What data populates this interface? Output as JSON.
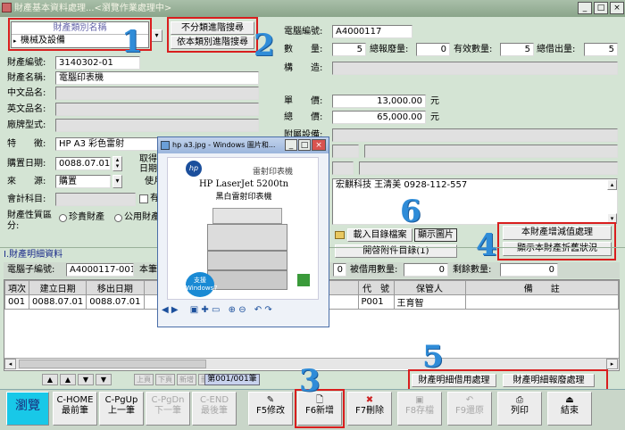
{
  "window": {
    "title": "財產基本資料處理...<瀏覽作業處理中>"
  },
  "category": {
    "header": "財產類別名稱",
    "value": "機械及設備"
  },
  "search_buttons": {
    "all": "不分類進階搜尋",
    "by_category": "依本類別進階搜尋"
  },
  "annotations": [
    "1",
    "2",
    "3",
    "4",
    "5",
    "6"
  ],
  "left_fields": {
    "asset_no_label": "財產編號:",
    "asset_no": "3140302-01",
    "asset_name_label": "財產名稱:",
    "asset_name": "電腦印表機",
    "chinese_name_label": "中文品名:",
    "english_name_label": "英文品名:",
    "model_label": "廠牌型式:",
    "feature_label": "特　　徵:",
    "feature": "HP A3 彩色雷射",
    "purchase_date_label": "購置日期:",
    "purchase_date": "0088.07.01",
    "source_label": "來　　源:",
    "source": "購置",
    "account_label": "會計科目:",
    "acquire_label": "取得",
    "date_label": "日期",
    "use_label": "使月",
    "has_label": "有",
    "nature_label": "財產性質區分:",
    "radio_precious": "珍貴財產",
    "radio_public": "公用財產"
  },
  "right_fields": {
    "computer_no_label": "電腦編號:",
    "computer_no": "A4000117",
    "qty_label": "數　　量:",
    "qty": "5",
    "total_scrap_label": "總報廢量:",
    "total_scrap": "0",
    "valid_qty_label": "有效數量:",
    "valid_qty": "5",
    "total_lent_label": "總借出量:",
    "total_lent": "5",
    "structure_label": "構　　造:",
    "unit_price_label": "單　　價:",
    "unit_price": "13,000.00",
    "unit_price_unit": "元",
    "total_price_label": "總　　價:",
    "total_price": "65,000.00",
    "total_price_unit": "元",
    "attach_label": "附屬設備:",
    "vendor_note": "宏麒科技 王清美 0928-112-557"
  },
  "attachment_buttons": {
    "load": "載入目錄檔案",
    "show_image": "顯示圖片",
    "open_list": "開啓附件目錄(1)"
  },
  "asset_value_buttons": {
    "depreciation": "本財產增減值處理",
    "show_discount": "顯示本財產折舊狀況"
  },
  "image_popup": {
    "title": "hp a3.jpg - Windows 圖片和...",
    "label": "雷射印表機",
    "product_line1": "HP LaserJet 5200tn",
    "product_line2": "黑白雷射印表機",
    "badge": "支援 Windows7"
  },
  "detail": {
    "section_title": "I.財產明細資料",
    "sub_no_label": "電腦子編號:",
    "sub_no": "A4000117-001",
    "this_label": "本筆",
    "lent_qty_label": "被借用數量:",
    "lent_qty": "0",
    "remaining_label": "剩餘數量:",
    "remaining": "0",
    "columns": [
      "項次",
      "建立日期",
      "移出日期",
      "代　號",
      "保管人",
      "備　　註"
    ],
    "rows": [
      {
        "no": "001",
        "created": "0088.07.01",
        "moved": "0088.07.01",
        "code": "P001",
        "keeper": "王育智",
        "note": ""
      }
    ],
    "nav_record": "第001/001筆",
    "nav_buttons": [
      "上頁",
      "下頁",
      "新增",
      "刪除"
    ],
    "borrow_button": "財產明細借用處理",
    "scrap_button": "財產明細報廢處理"
  },
  "bottom_toolbar": {
    "browse": "瀏覽",
    "home": [
      "C-HOME",
      "最前筆"
    ],
    "pgup": [
      "C-PgUp",
      "上一筆"
    ],
    "pgdn": [
      "C-PgDn",
      "下一筆"
    ],
    "end": [
      "C-END",
      "最後筆"
    ],
    "f5": "F5修改",
    "f6": "F6新增",
    "f7": "F7刪除",
    "f8": "F8存檔",
    "f9": "F9還原",
    "print": "列印",
    "exit": "結束"
  },
  "colors": {
    "background": "#d4e4d4",
    "highlight_red": "#d91e1e",
    "annotation_blue": "#2f8cd8"
  }
}
